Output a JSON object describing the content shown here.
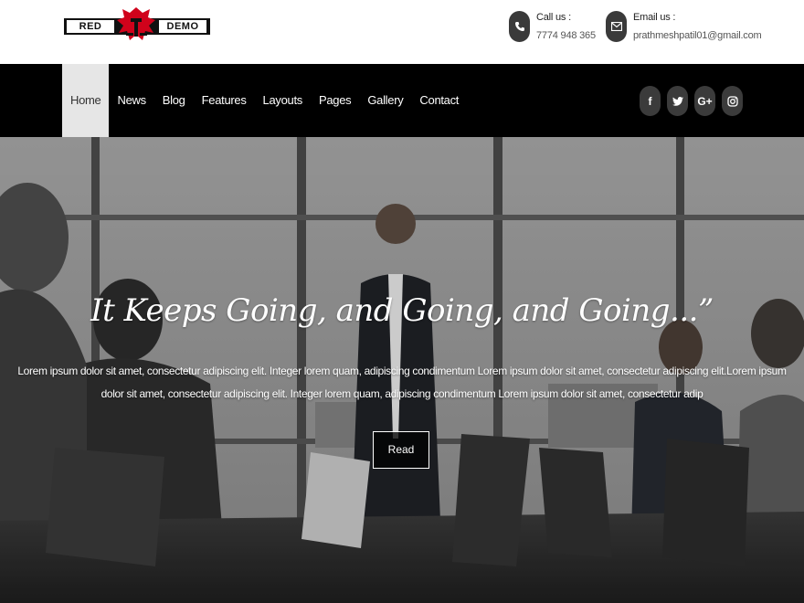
{
  "logo": {
    "left_word": "RED",
    "right_word": "DEMO"
  },
  "contact": {
    "call_label": "Call us :",
    "call_value": "7774 948 365",
    "email_label": "Email us :",
    "email_value": "prathmeshpatil01@gmail.com"
  },
  "nav": {
    "items": [
      {
        "label": "Home",
        "active": true
      },
      {
        "label": "News"
      },
      {
        "label": "Blog"
      },
      {
        "label": "Features"
      },
      {
        "label": "Layouts"
      },
      {
        "label": "Pages"
      },
      {
        "label": "Gallery"
      },
      {
        "label": "Contact"
      }
    ]
  },
  "social": {
    "icons": [
      "facebook-icon",
      "twitter-icon",
      "google-plus-icon",
      "instagram-icon"
    ],
    "facebook_glyph": "f",
    "twitter_glyph": "t",
    "google_glyph": "G+",
    "instagram_glyph": "◎"
  },
  "hero": {
    "title": "It Keeps Going, and Going, and Going...”",
    "body": "Lorem ipsum dolor sit amet, consectetur adipiscing elit. Integer lorem quam, adipiscing condimentum Lorem ipsum dolor sit amet, consectetur adipiscing elit.Lorem ipsum dolor sit amet, consectetur adipiscing elit. Integer lorem quam, adipiscing condimentum Lorem ipsum dolor sit amet, consectetur adip",
    "button_label": "Read"
  },
  "colors": {
    "nav_bg": "#000000",
    "accent_red": "#d0021b",
    "active_bg": "#e6e6e6"
  }
}
